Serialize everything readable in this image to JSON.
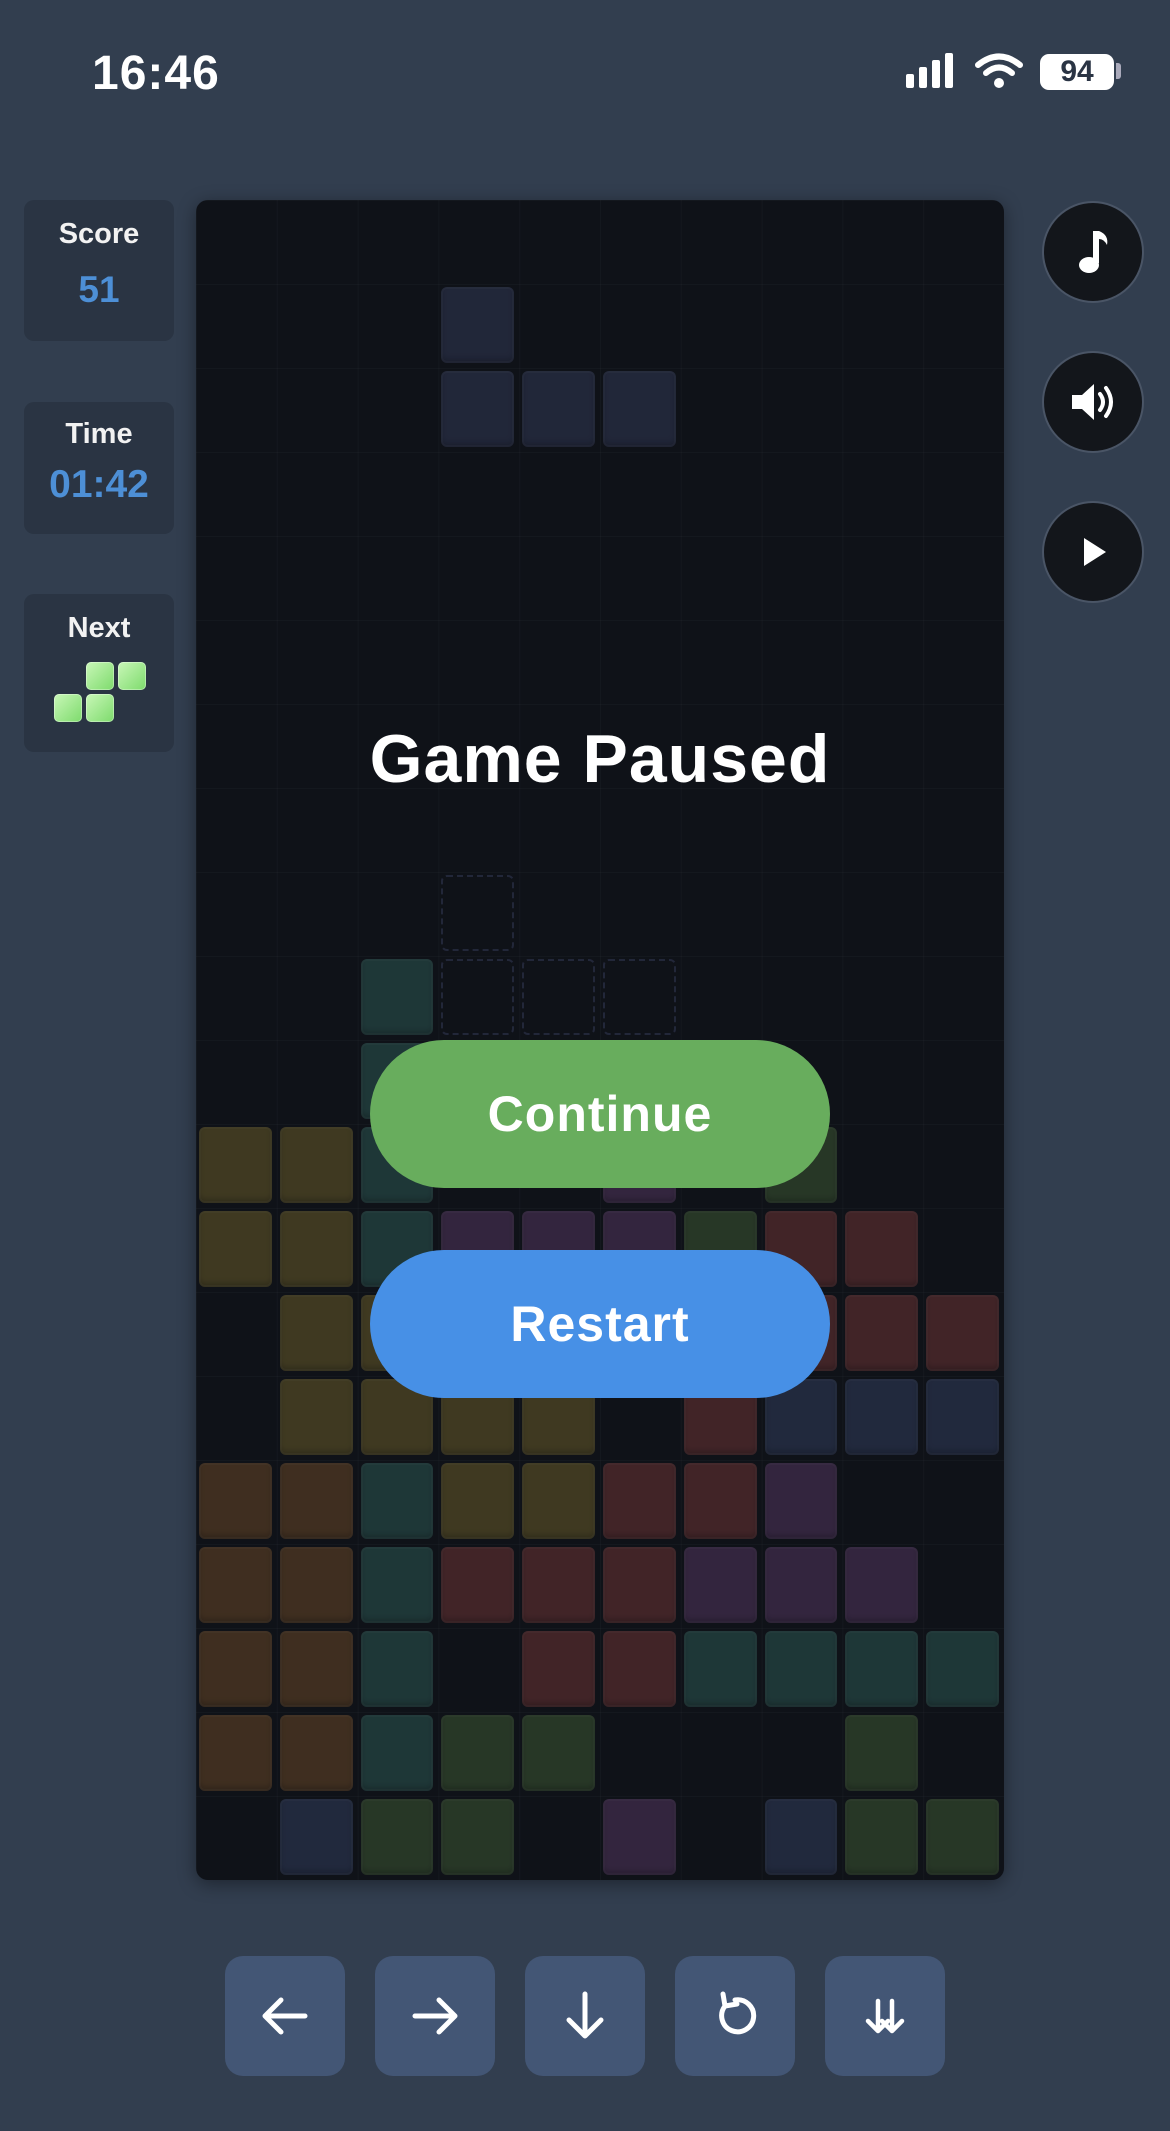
{
  "status": {
    "time": "16:46",
    "battery": "94"
  },
  "sidebar": {
    "score_label": "Score",
    "score_value": "51",
    "time_label": "Time",
    "time_value": "01:42",
    "next_label": "Next"
  },
  "next_piece": {
    "type": "S",
    "color": "#9be88a"
  },
  "overlay": {
    "title": "Game Paused",
    "continue_label": "Continue",
    "restart_label": "Restart"
  },
  "side_controls": [
    "music-icon",
    "volume-icon",
    "play-icon"
  ],
  "controls": [
    "arrow-left-icon",
    "arrow-right-icon",
    "arrow-down-icon",
    "rotate-icon",
    "hard-drop-icon"
  ],
  "colors": {
    "Y": "#6a5e2c",
    "O": "#6a4a2a",
    "T": "#2f5a55",
    "R": "#6e3838",
    "P": "#553a62",
    "B": "#34405f",
    "G": "#3f5a36",
    "active": "#343c58"
  },
  "board": {
    "cols": 10,
    "rows": 20,
    "active": [
      [
        3,
        1
      ],
      [
        3,
        2
      ],
      [
        4,
        2
      ],
      [
        5,
        2
      ]
    ],
    "ghost": [
      [
        3,
        8
      ],
      [
        3,
        9
      ],
      [
        4,
        9
      ],
      [
        5,
        9
      ]
    ],
    "grid": [
      "..........",
      "..........",
      "..........",
      "..........",
      "..........",
      "..........",
      "..........",
      "..........",
      "..........",
      "..T.......",
      "..T.......",
      "YYT..P.G..",
      "YYTPPPGRR.",
      ".YYYYRRRRR",
      ".YYYY.RBBB",
      "OOTYYRRP..",
      "OOTRRRPPP.",
      "OOT.RRTTTT",
      "OOTGG...G.",
      ".BGG.P.BGG"
    ]
  }
}
